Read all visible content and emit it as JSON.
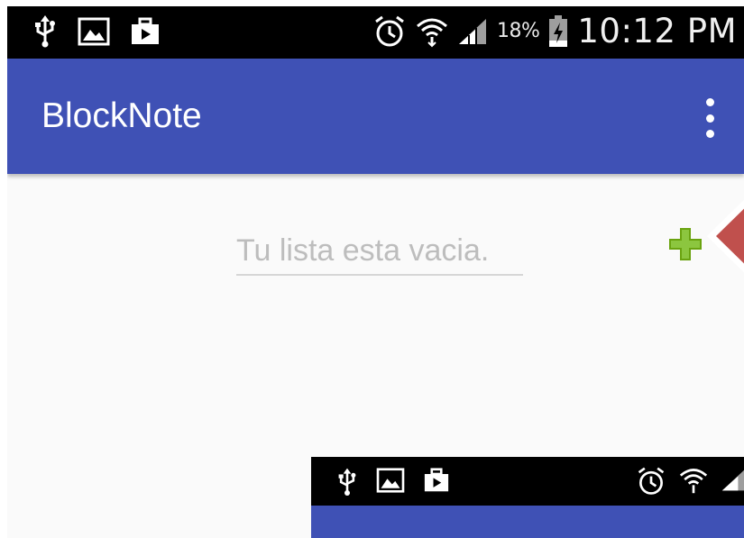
{
  "status_bar": {
    "left_icons": [
      "usb-icon",
      "image-icon",
      "briefcase-icon"
    ],
    "right_icons": [
      "alarm-icon",
      "wifi-icon",
      "signal-icon",
      "battery-charging-icon"
    ],
    "battery_percent": "18%",
    "time": "10:12 PM"
  },
  "toolbar": {
    "title": "BlockNote",
    "menu_icon": "more-vert-icon"
  },
  "content": {
    "empty_placeholder": "Tu lista esta vacia.",
    "add_icon": "plus-icon"
  },
  "colors": {
    "primary": "#3f51b5",
    "add_green": "#7cb518",
    "callout_red": "#c0504d",
    "background": "#fafafa"
  }
}
